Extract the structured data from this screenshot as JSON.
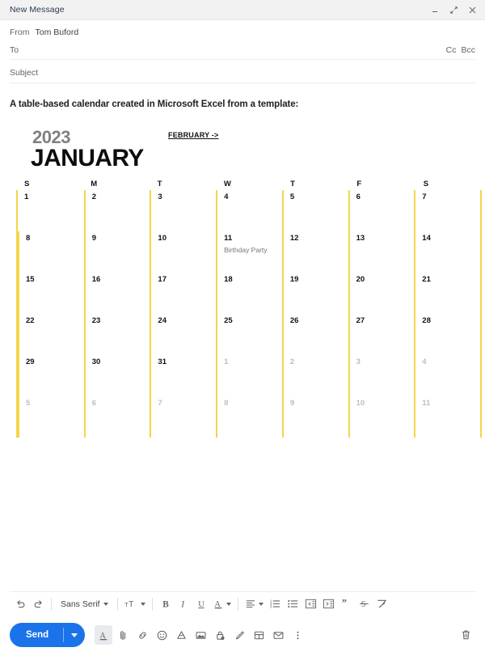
{
  "window": {
    "title": "New Message",
    "controls": [
      {
        "name": "minimize-button",
        "icon": "minimize-icon"
      },
      {
        "name": "expand-button",
        "icon": "expand-icon"
      },
      {
        "name": "close-button",
        "icon": "close-icon"
      }
    ]
  },
  "fields": {
    "from_label": "From",
    "from_value": "Tom Buford",
    "to_label": "To",
    "to_value": "",
    "cc_label": "Cc",
    "bcc_label": "Bcc",
    "subject_label": "Subject",
    "subject_value": ""
  },
  "body": {
    "heading": "A table-based calendar created in Microsoft Excel from a template:"
  },
  "calendar": {
    "year": "2023",
    "month": "JANUARY",
    "next_link": "FEBRUARY ->",
    "accent_color": "#f2d64b",
    "dow": [
      "S",
      "M",
      "T",
      "W",
      "T",
      "F",
      "S"
    ],
    "weeks": [
      [
        {
          "day": "1",
          "muted": false,
          "event": ""
        },
        {
          "day": "2",
          "muted": false,
          "event": ""
        },
        {
          "day": "3",
          "muted": false,
          "event": ""
        },
        {
          "day": "4",
          "muted": false,
          "event": ""
        },
        {
          "day": "5",
          "muted": false,
          "event": ""
        },
        {
          "day": "6",
          "muted": false,
          "event": ""
        },
        {
          "day": "7",
          "muted": false,
          "event": ""
        }
      ],
      [
        {
          "day": "8",
          "muted": false,
          "event": ""
        },
        {
          "day": "9",
          "muted": false,
          "event": ""
        },
        {
          "day": "10",
          "muted": false,
          "event": ""
        },
        {
          "day": "11",
          "muted": false,
          "event": "Birthday Party"
        },
        {
          "day": "12",
          "muted": false,
          "event": ""
        },
        {
          "day": "13",
          "muted": false,
          "event": ""
        },
        {
          "day": "14",
          "muted": false,
          "event": ""
        }
      ],
      [
        {
          "day": "15",
          "muted": false,
          "event": ""
        },
        {
          "day": "16",
          "muted": false,
          "event": ""
        },
        {
          "day": "17",
          "muted": false,
          "event": ""
        },
        {
          "day": "18",
          "muted": false,
          "event": ""
        },
        {
          "day": "19",
          "muted": false,
          "event": ""
        },
        {
          "day": "20",
          "muted": false,
          "event": ""
        },
        {
          "day": "21",
          "muted": false,
          "event": ""
        }
      ],
      [
        {
          "day": "22",
          "muted": false,
          "event": ""
        },
        {
          "day": "23",
          "muted": false,
          "event": ""
        },
        {
          "day": "24",
          "muted": false,
          "event": ""
        },
        {
          "day": "25",
          "muted": false,
          "event": ""
        },
        {
          "day": "26",
          "muted": false,
          "event": ""
        },
        {
          "day": "27",
          "muted": false,
          "event": ""
        },
        {
          "day": "28",
          "muted": false,
          "event": ""
        }
      ],
      [
        {
          "day": "29",
          "muted": false,
          "event": ""
        },
        {
          "day": "30",
          "muted": false,
          "event": ""
        },
        {
          "day": "31",
          "muted": false,
          "event": ""
        },
        {
          "day": "1",
          "muted": true,
          "event": ""
        },
        {
          "day": "2",
          "muted": true,
          "event": ""
        },
        {
          "day": "3",
          "muted": true,
          "event": ""
        },
        {
          "day": "4",
          "muted": true,
          "event": ""
        }
      ],
      [
        {
          "day": "5",
          "muted": true,
          "event": ""
        },
        {
          "day": "6",
          "muted": true,
          "event": ""
        },
        {
          "day": "7",
          "muted": true,
          "event": ""
        },
        {
          "day": "8",
          "muted": true,
          "event": ""
        },
        {
          "day": "9",
          "muted": true,
          "event": ""
        },
        {
          "day": "10",
          "muted": true,
          "event": ""
        },
        {
          "day": "11",
          "muted": true,
          "event": ""
        }
      ]
    ]
  },
  "format_toolbar": {
    "font_name": "Sans Serif",
    "items": [
      {
        "name": "undo-button",
        "icon": "undo-icon"
      },
      {
        "name": "redo-button",
        "icon": "redo-icon"
      },
      {
        "name": "font-family-select",
        "icon": "chevron-down-icon"
      },
      {
        "name": "font-size-button",
        "icon": "font-size-icon"
      },
      {
        "name": "bold-button",
        "icon": "bold-icon"
      },
      {
        "name": "italic-button",
        "icon": "italic-icon"
      },
      {
        "name": "underline-button",
        "icon": "underline-icon"
      },
      {
        "name": "text-color-button",
        "icon": "text-color-icon"
      },
      {
        "name": "align-button",
        "icon": "align-icon"
      },
      {
        "name": "numbered-list-button",
        "icon": "numbered-list-icon"
      },
      {
        "name": "bulleted-list-button",
        "icon": "bulleted-list-icon"
      },
      {
        "name": "indent-less-button",
        "icon": "indent-less-icon"
      },
      {
        "name": "indent-more-button",
        "icon": "indent-more-icon"
      },
      {
        "name": "quote-button",
        "icon": "quote-icon"
      },
      {
        "name": "strikethrough-button",
        "icon": "strikethrough-icon"
      },
      {
        "name": "remove-formatting-button",
        "icon": "remove-formatting-icon"
      }
    ]
  },
  "send_bar": {
    "send_label": "Send",
    "icons": [
      {
        "name": "formatting-options-button",
        "icon": "text-format-icon"
      },
      {
        "name": "attach-file-button",
        "icon": "paperclip-icon"
      },
      {
        "name": "insert-link-button",
        "icon": "link-icon"
      },
      {
        "name": "insert-emoji-button",
        "icon": "emoji-icon"
      },
      {
        "name": "insert-drive-file-button",
        "icon": "drive-icon"
      },
      {
        "name": "insert-photo-button",
        "icon": "image-icon"
      },
      {
        "name": "confidential-mode-button",
        "icon": "lock-clock-icon"
      },
      {
        "name": "insert-signature-button",
        "icon": "pen-icon"
      },
      {
        "name": "layout-button",
        "icon": "layout-icon"
      },
      {
        "name": "mail-template-button",
        "icon": "mail-icon"
      },
      {
        "name": "more-options-button",
        "icon": "more-vertical-icon"
      }
    ],
    "discard_name": "discard-draft-button"
  }
}
